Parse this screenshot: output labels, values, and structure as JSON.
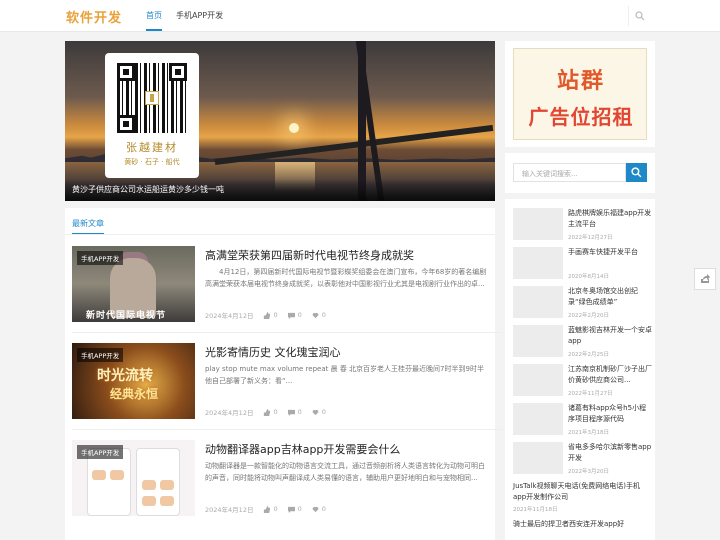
{
  "header": {
    "logo": "软件开发",
    "nav": [
      {
        "label": "首页"
      },
      {
        "label": "手机APP开发"
      }
    ]
  },
  "hero": {
    "card_name": "张越建材",
    "card_tags": "黄砂 · 石子 · 船代",
    "caption": "黄沙子供应商公司水运船运黄沙多少钱一吨"
  },
  "latest": {
    "section_title": "最新文章",
    "articles": [
      {
        "category": "手机APP开发",
        "title": "高满堂荣获第四届新时代电视节终身成就奖",
        "excerpt": "4月12日，第四届新时代国际电视节暨彩蝶奖组委会在澳门宣布，今年68岁的著名编剧高满堂荣获本届电视节终身成就奖，以表彰他对中国影视行业尤其是电视剧行业作出的卓...",
        "date": "2024年4月12日",
        "likes": "0",
        "comments": "0",
        "favorites": "0",
        "thumb_text": "新时代国际电视节"
      },
      {
        "category": "手机APP开发",
        "title": "光影寄情历史 文化瑰宝润心",
        "excerpt": "play stop mute max volume    repeat  晨 春 北京百岁老人王桂芬最近晚间7时半到9时半他自己部署了新义务：看“...",
        "date": "2024年4月12日",
        "likes": "0",
        "comments": "0",
        "favorites": "0",
        "thumb_text_1": "时光流转",
        "thumb_text_2": "经典永恒"
      },
      {
        "category": "手机APP开发",
        "title": "动物翻译器app吉林app开发需要会什么",
        "excerpt": "动物翻译器是一款智能化的动物语言交流工具，通过音频剖析将人类语言转化为动物可明白的声音，同时能将动物叫声翻译成人类易懂的语言，辅助用户更好地明白和与宠物相同...",
        "date": "2024年4月12日",
        "likes": "0",
        "comments": "0",
        "favorites": "0"
      }
    ]
  },
  "sidebar": {
    "ad_line1": "站群",
    "ad_line2": "广告位招租",
    "search_placeholder": "输入关键词搜索...",
    "list": [
      {
        "title": "路虎棋牌娱乐福建app开发主流平台",
        "date": "2022年12月27日"
      },
      {
        "title": "手画赛车快捷开发平台",
        "date": "2020年8月14日"
      },
      {
        "title": "北京冬奥场馆交出创纪录“绿色成绩单”",
        "date": "2022年2月20日"
      },
      {
        "title": "蓝魅影视吉林开发一个安卓app",
        "date": "2022年2月25日"
      },
      {
        "title": "江苏南京机制砂厂沙子出厂价黄砂供应商公司...",
        "date": "2022年11月27日"
      },
      {
        "title": "诸葛有料app众号h5小程序项目程序源代码",
        "date": "2021年3月18日"
      },
      {
        "title": "省电多多哈尔滨新零售app开发",
        "date": "2022年3月20日"
      }
    ],
    "text_items": [
      {
        "title": "JusTalk视频聊天电话(免费网络电话)手机app开发制作公司",
        "date": "2021年11月18日"
      },
      {
        "title": "骑士最后的捍卫者西安连开发app好"
      }
    ],
    "colors": {
      "accent": "#1e88c8",
      "logo": "#e8a23a",
      "ad_red": "#e24632"
    }
  }
}
